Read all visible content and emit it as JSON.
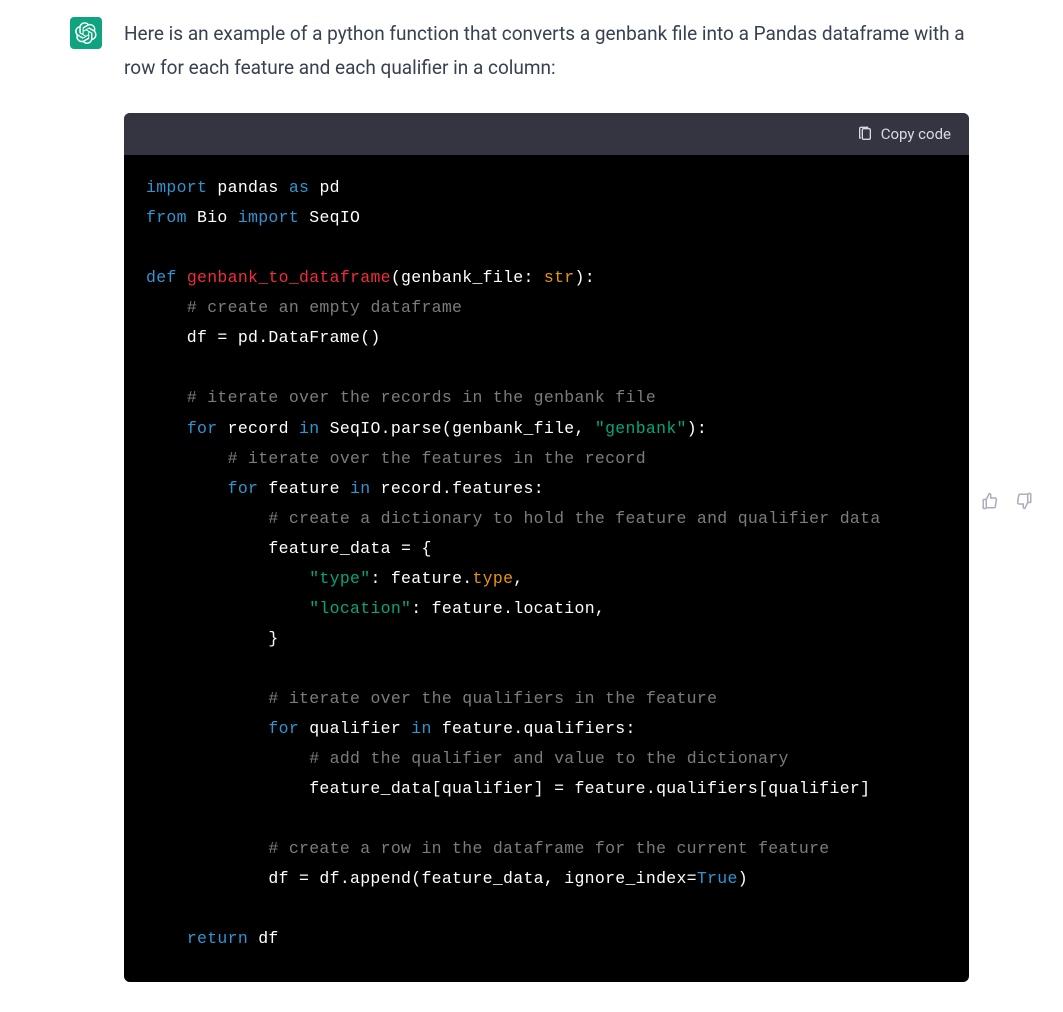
{
  "message": {
    "intro": "Here is an example of a python function that converts a genbank file into a Pandas dataframe with a row for each feature and each qualifier in a column:"
  },
  "codeblock": {
    "copy_label": "Copy code"
  },
  "code": {
    "kw_import1": "import",
    "t1": " pandas ",
    "kw_as": "as",
    "t2": " pd",
    "kw_from": "from",
    "t3": " Bio ",
    "kw_import2": "import",
    "t4": " SeqIO",
    "kw_def": "def",
    "t5": " ",
    "fn_name": "genbank_to_dataframe",
    "t6": "(genbank_file: ",
    "ty_str": "str",
    "t7": "):",
    "c1": "# create an empty dataframe",
    "l1": "    df = pd.DataFrame()",
    "c2": "# iterate over the records in the genbank file",
    "kw_for1": "for",
    "t8": " record ",
    "kw_in1": "in",
    "t9": " SeqIO.parse(genbank_file, ",
    "s_genbank": "\"genbank\"",
    "t10": "):",
    "c3": "# iterate over the features in the record",
    "kw_for2": "for",
    "t11": " feature ",
    "kw_in2": "in",
    "t12": " record.features:",
    "c4": "# create a dictionary to hold the feature and qualifier data",
    "l2": "            feature_data = {",
    "s_type": "\"type\"",
    "t13": ": feature.",
    "ty_type": "type",
    "t14": ",",
    "s_location": "\"location\"",
    "t15": ": feature.location,",
    "l3": "            }",
    "c5": "# iterate over the qualifiers in the feature",
    "kw_for3": "for",
    "t16": " qualifier ",
    "kw_in3": "in",
    "t17": " feature.qualifiers:",
    "c6": "# add the qualifier and value to the dictionary",
    "l4": "                feature_data[qualifier] = feature.qualifiers[qualifier]",
    "c7": "# create a row in the dataframe for the current feature",
    "l5a": "            df = df.append(feature_data, ignore_index=",
    "b_true": "True",
    "l5b": ")",
    "kw_return": "return",
    "t18": " df"
  }
}
